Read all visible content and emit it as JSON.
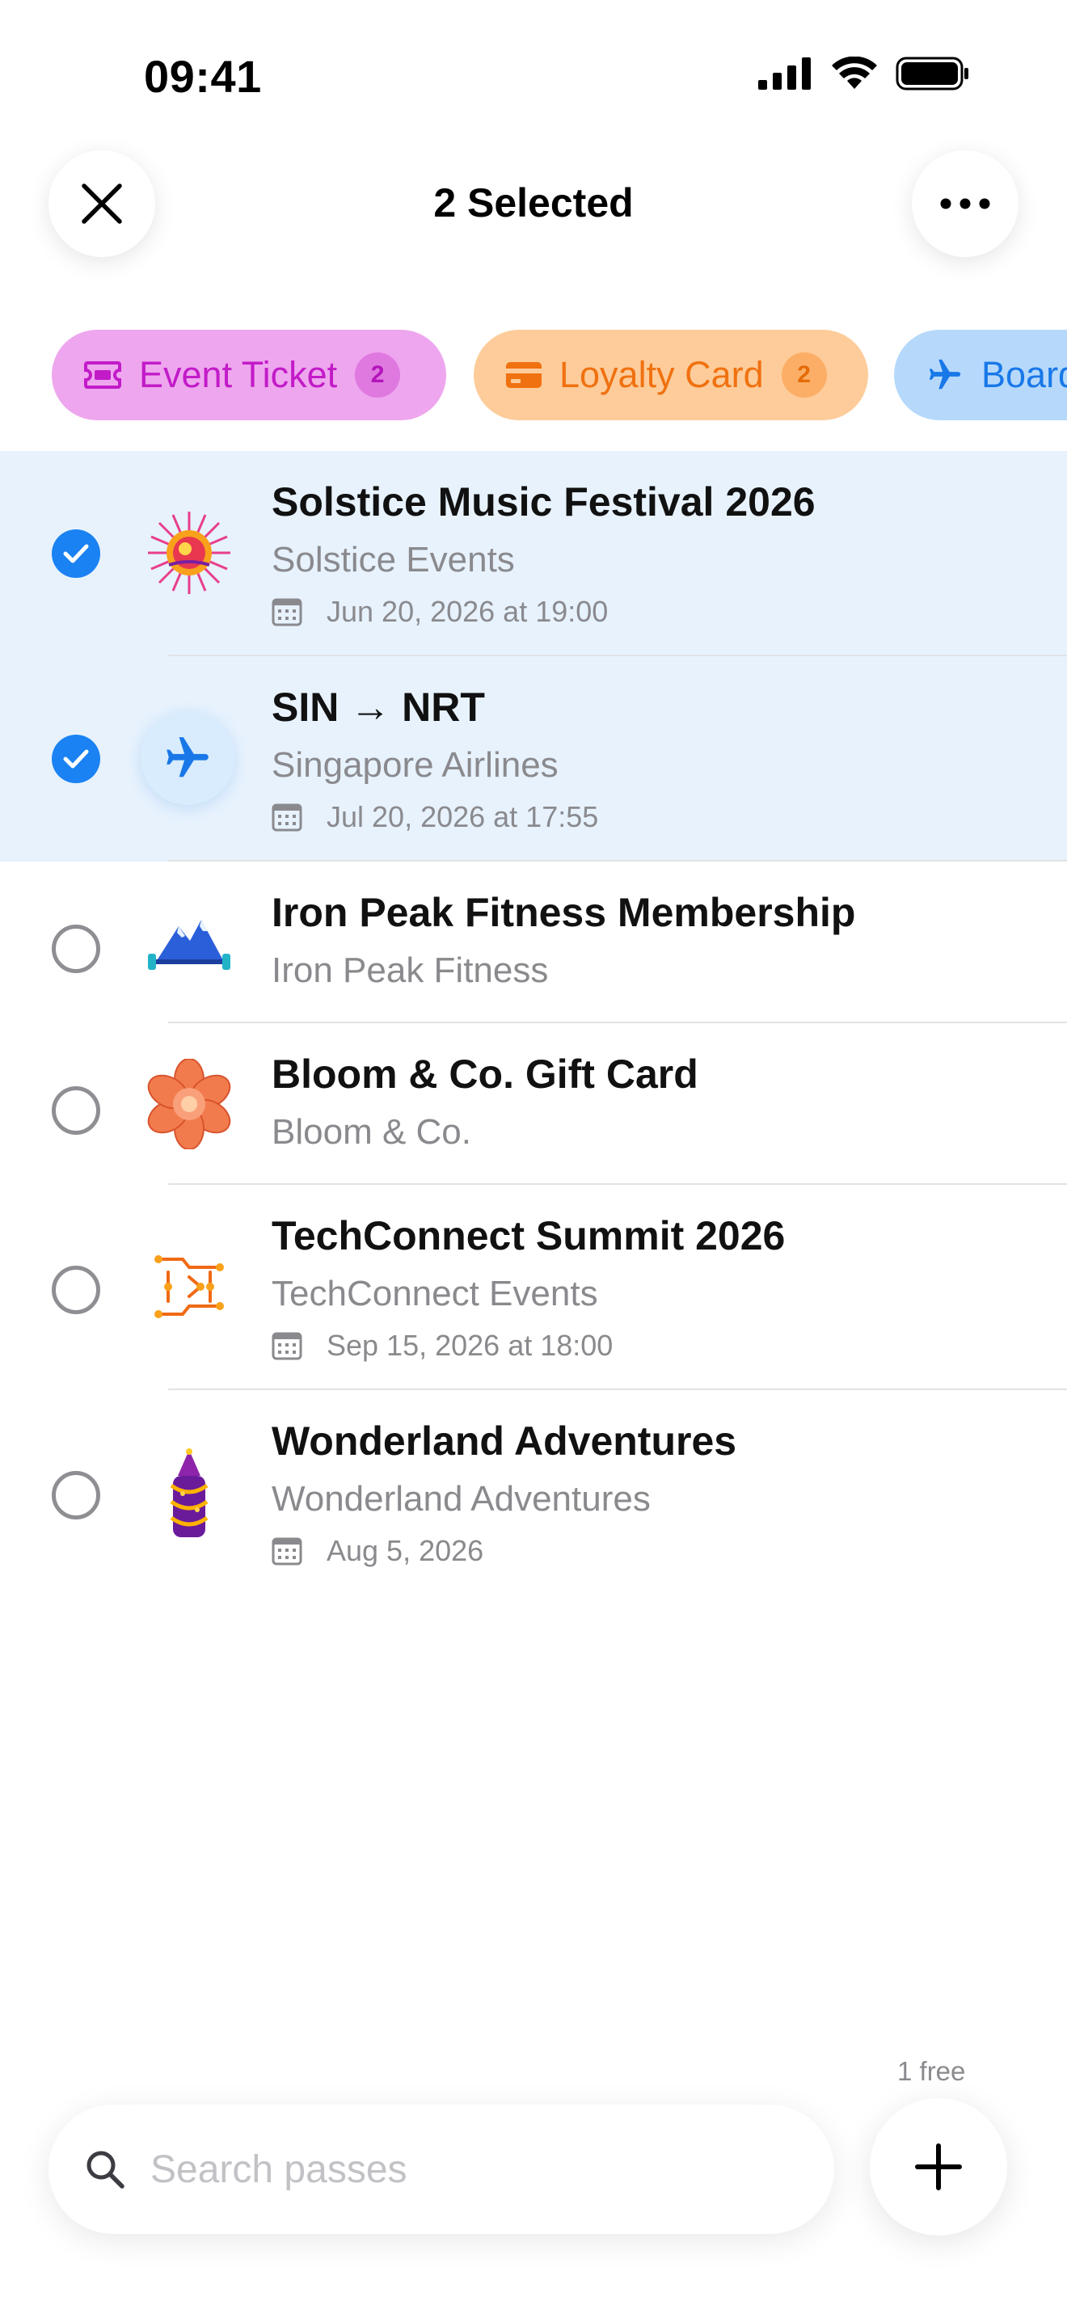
{
  "status_bar": {
    "time": "09:41"
  },
  "header": {
    "title": "2 Selected"
  },
  "chips": [
    {
      "label": "Event Ticket",
      "count": "2",
      "icon": "ticket-icon"
    },
    {
      "label": "Loyalty Card",
      "count": "2",
      "icon": "card-icon"
    },
    {
      "label": "Boarding Pass",
      "icon": "airplane-icon"
    }
  ],
  "passes": [
    {
      "title": "Solstice Music Festival 2026",
      "subtitle": "Solstice Events",
      "date": "Jun 20, 2026 at 19:00",
      "selected": true,
      "icon": "sun-festival-icon"
    },
    {
      "title": "SIN → NRT",
      "subtitle": "Singapore Airlines",
      "date": "Jul 20, 2026 at 17:55",
      "selected": true,
      "icon": "airplane-icon"
    },
    {
      "title": "Iron Peak Fitness Membership",
      "subtitle": "Iron Peak Fitness",
      "selected": false,
      "icon": "mountain-dumbbell-icon"
    },
    {
      "title": "Bloom & Co. Gift Card",
      "subtitle": "Bloom & Co.",
      "selected": false,
      "icon": "flower-icon"
    },
    {
      "title": "TechConnect Summit 2026",
      "subtitle": "TechConnect Events",
      "date": "Sep 15, 2026 at 18:00",
      "selected": false,
      "icon": "circuit-icon"
    },
    {
      "title": "Wonderland Adventures",
      "subtitle": "Wonderland Adventures",
      "date": "Aug 5, 2026",
      "selected": false,
      "icon": "castle-icon"
    }
  ],
  "footer": {
    "free_label": "1 free",
    "search_placeholder": "Search passes"
  },
  "colors": {
    "accent": "#1a82f2",
    "selected_row": "#e7f2fd",
    "event_chip": "#eea6ee",
    "loyalty_chip": "#fdcc9a",
    "boarding_chip": "#b6d9fb"
  }
}
